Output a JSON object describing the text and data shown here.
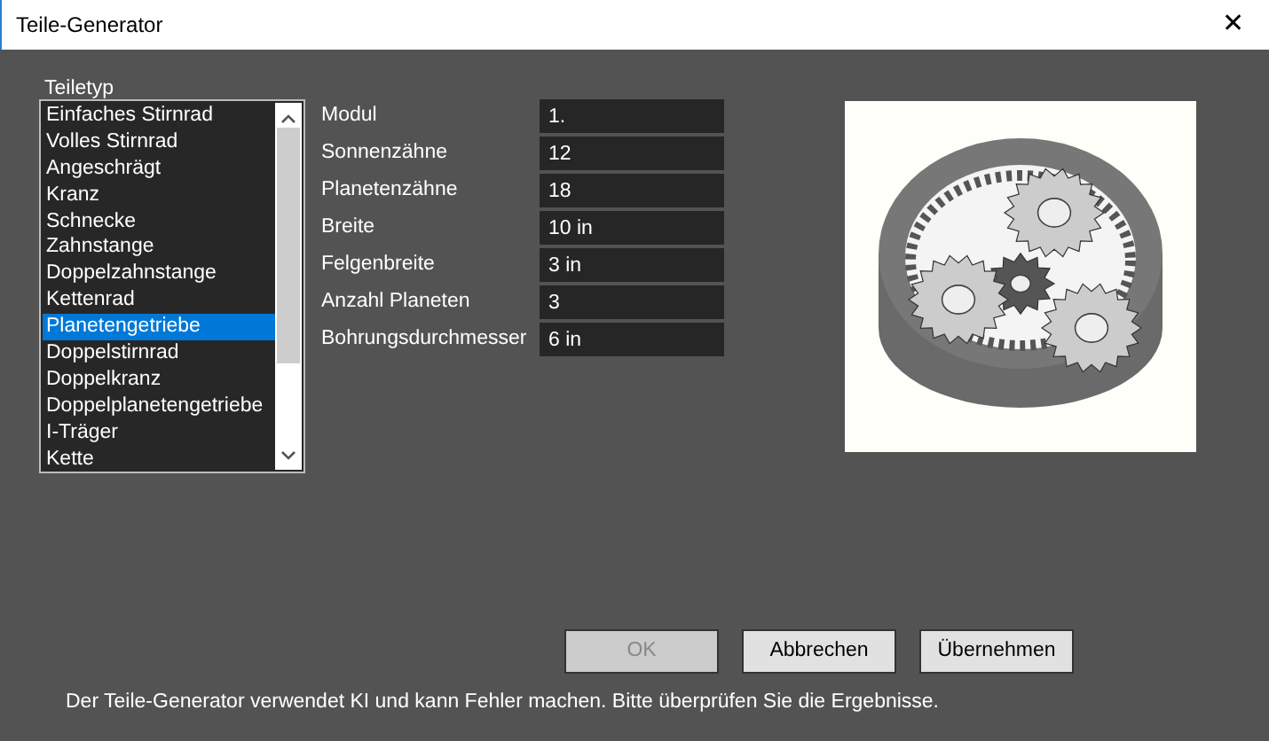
{
  "window": {
    "title": "Teile-Generator",
    "close": "✕"
  },
  "part_type": {
    "label": "Teiletyp",
    "items": [
      {
        "label": "Einfaches Stirnrad",
        "selected": false
      },
      {
        "label": "Volles Stirnrad",
        "selected": false
      },
      {
        "label": "Angeschrägt",
        "selected": false
      },
      {
        "label": "Kranz",
        "selected": false
      },
      {
        "label": "Schnecke",
        "selected": false
      },
      {
        "label": "Zahnstange",
        "selected": false
      },
      {
        "label": "Doppelzahnstange",
        "selected": false
      },
      {
        "label": "Kettenrad",
        "selected": false
      },
      {
        "label": "Planetengetriebe",
        "selected": true
      },
      {
        "label": "Doppelstirnrad",
        "selected": false
      },
      {
        "label": "Doppelkranz",
        "selected": false
      },
      {
        "label": "Doppelplanetengetriebe",
        "selected": false
      },
      {
        "label": "I-Träger",
        "selected": false
      },
      {
        "label": "Kette",
        "selected": false
      }
    ]
  },
  "parameters": [
    {
      "label": "Modul",
      "value": "1."
    },
    {
      "label": "Sonnenzähne",
      "value": "12"
    },
    {
      "label": "Planetenzähne",
      "value": "18"
    },
    {
      "label": "Breite",
      "value": "10 in"
    },
    {
      "label": "Felgenbreite",
      "value": "3 in"
    },
    {
      "label": "Anzahl Planeten",
      "value": "3"
    },
    {
      "label": "Bohrungsdurchmesser",
      "value": "6 in"
    }
  ],
  "buttons": [
    {
      "label": "OK",
      "disabled": true
    },
    {
      "label": "Abbrechen",
      "disabled": false
    },
    {
      "label": "Übernehmen",
      "disabled": false
    }
  ],
  "footer": "Der Teile-Generator verwendet KI und kann Fehler machen. Bitte überprüfen Sie die Ergebnisse."
}
